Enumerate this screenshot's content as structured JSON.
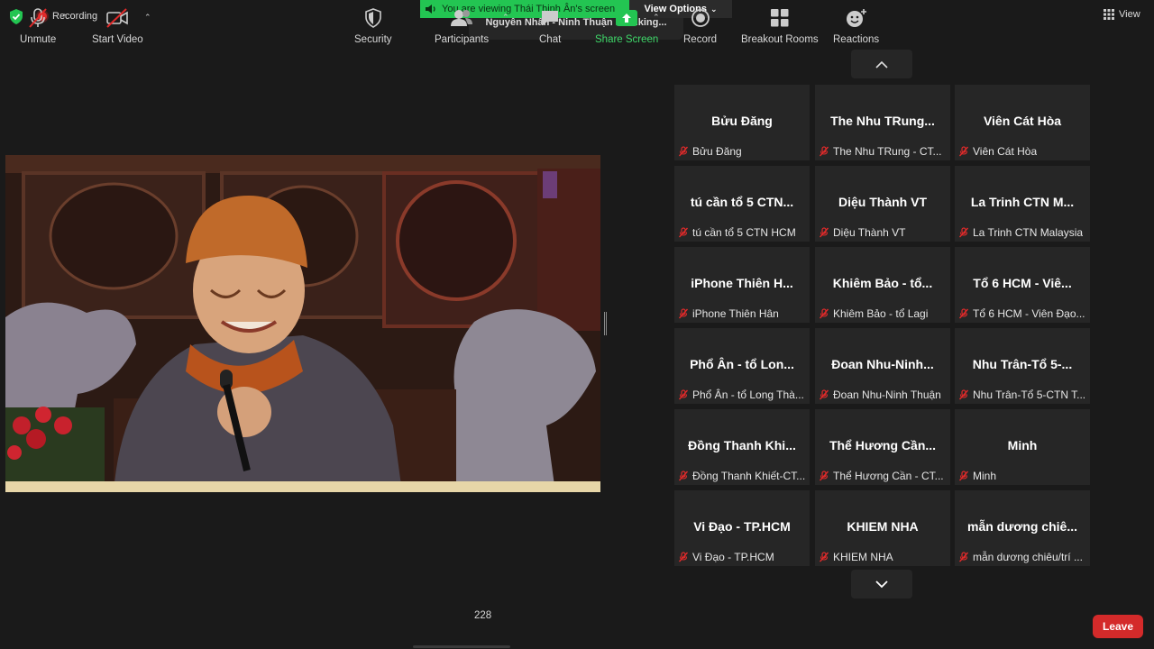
{
  "top": {
    "recording_label": "Recording",
    "viewing_banner": "You are viewing Thái Thịnh Ân's screen",
    "view_options_label": "View Options",
    "talking_status": "Nguyên Nhân - Ninh Thuận is talking...",
    "view_label": "View"
  },
  "gallery": {
    "tiles": [
      {
        "name": "Bửu Đăng",
        "label": "Bửu Đăng"
      },
      {
        "name": "The Nhu TRung...",
        "label": "The Nhu TRung - CT..."
      },
      {
        "name": "Viên Cát Hòa",
        "label": "Viên Cát Hòa"
      },
      {
        "name": "tú cần tổ 5 CTN...",
        "label": "tú cần tổ 5 CTN HCM"
      },
      {
        "name": "Diệu Thành VT",
        "label": "Diệu Thành VT"
      },
      {
        "name": "La Trinh CTN M...",
        "label": "La Trinh CTN Malaysia"
      },
      {
        "name": "iPhone Thiên H...",
        "label": "iPhone Thiên Hân"
      },
      {
        "name": "Khiêm Bảo - tổ...",
        "label": "Khiêm Bảo - tổ Lagi"
      },
      {
        "name": "Tổ 6 HCM - Viê...",
        "label": "Tổ 6 HCM - Viên Đạo..."
      },
      {
        "name": "Phổ Ân - tổ Lon...",
        "label": "Phổ Ân - tổ Long Thà..."
      },
      {
        "name": "Đoan Nhu-Ninh...",
        "label": "Đoan Nhu-Ninh Thuận"
      },
      {
        "name": "Nhu Trân-Tổ 5-...",
        "label": "Nhu Trân-Tổ 5-CTN T..."
      },
      {
        "name": "Đồng Thanh Khi...",
        "label": "Đồng Thanh Khiết-CT..."
      },
      {
        "name": "Thể Hương Cần...",
        "label": "Thể Hương Cần - CT..."
      },
      {
        "name": "Minh",
        "label": "Minh"
      },
      {
        "name": "Vi Đạo - TP.HCM",
        "label": "Vi Đạo - TP.HCM"
      },
      {
        "name": "KHIEM NHA",
        "label": "KHIEM NHA"
      },
      {
        "name": "mẫn dương chiê...",
        "label": "mẫn dương chiêu/trí ..."
      }
    ]
  },
  "toolbar": {
    "unmute": "Unmute",
    "start_video": "Start Video",
    "security": "Security",
    "participants": "Participants",
    "participant_count": "228",
    "chat": "Chat",
    "share_screen": "Share Screen",
    "record": "Record",
    "breakout_rooms": "Breakout Rooms",
    "reactions": "Reactions",
    "leave": "Leave"
  },
  "colors": {
    "share_green": "#23c552",
    "leave_red": "#d42a2a",
    "mute_red": "#e02a2a"
  }
}
